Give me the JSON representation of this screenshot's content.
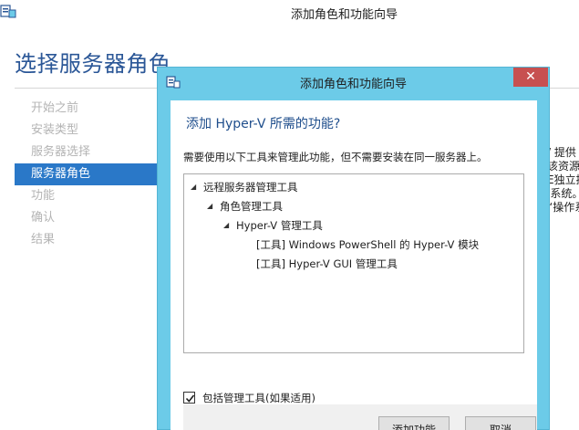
{
  "background_window": {
    "title": "添加角色和功能向导",
    "heading": "选择服务器角色",
    "steps": [
      {
        "label": "开始之前",
        "active": false
      },
      {
        "label": "安装类型",
        "active": false
      },
      {
        "label": "服务器选择",
        "active": false
      },
      {
        "label": "服务器角色",
        "active": true
      },
      {
        "label": "功能",
        "active": false
      },
      {
        "label": "确认",
        "active": false
      },
      {
        "label": "结果",
        "active": false
      }
    ],
    "description_lines": [
      "/ 提供",
      "该资源的",
      "E独立控",
      "l系统。",
      "“操作系"
    ]
  },
  "dialog": {
    "title": "添加角色和功能向导",
    "close_glyph": "✕",
    "question": "添加 Hyper-V 所需的功能?",
    "info": "需要使用以下工具来管理此功能，但不需要安装在同一服务器上。",
    "tree": [
      {
        "label": "远程服务器管理工具",
        "expanded": true
      },
      {
        "label": "角色管理工具",
        "expanded": true
      },
      {
        "label": "Hyper-V 管理工具",
        "expanded": true
      },
      {
        "label": "[工具] Windows PowerShell 的 Hyper-V 模块"
      },
      {
        "label": "[工具] Hyper-V GUI 管理工具"
      }
    ],
    "include_tools_label": "包括管理工具(如果适用)",
    "include_tools_checked": true,
    "add_button": "添加功能",
    "cancel_button": "取消"
  },
  "colors": {
    "dialog_frame": "#6ccbe8",
    "close_button": "#c75050",
    "active_step": "#2a78c8",
    "heading": "#2b5797"
  }
}
